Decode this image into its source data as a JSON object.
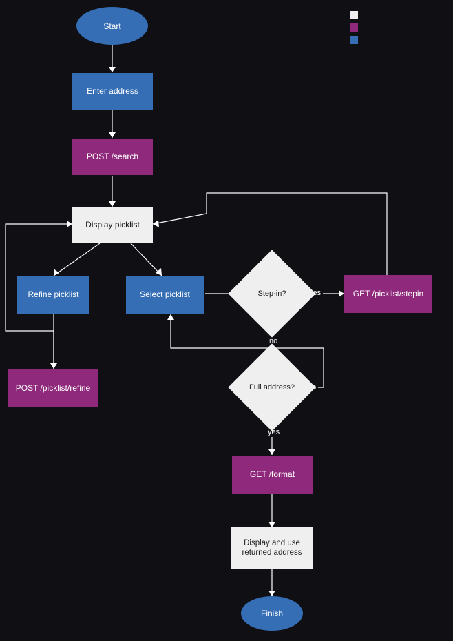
{
  "chart_data": {
    "type": "flowchart",
    "title": "",
    "nodes": [
      {
        "id": "start",
        "label": "Start",
        "shape": "ellipse",
        "color": "blue"
      },
      {
        "id": "enter_addr",
        "label": "Enter address",
        "shape": "rect",
        "color": "blue"
      },
      {
        "id": "post_search",
        "label": "POST /search",
        "shape": "rect",
        "color": "purple"
      },
      {
        "id": "display_pl",
        "label": "Display picklist",
        "shape": "rect",
        "color": "white"
      },
      {
        "id": "refine_pl",
        "label": "Refine picklist",
        "shape": "rect",
        "color": "blue"
      },
      {
        "id": "select_pl",
        "label": "Select picklist",
        "shape": "rect",
        "color": "blue"
      },
      {
        "id": "stepin_q",
        "label": "Step-in?",
        "shape": "diamond",
        "color": "white"
      },
      {
        "id": "stepin_api",
        "label": "GET /picklist/stepin",
        "shape": "rect",
        "color": "purple"
      },
      {
        "id": "post_refine",
        "label": "POST /picklist/refine",
        "shape": "rect",
        "color": "purple"
      },
      {
        "id": "fulladdr_q",
        "label": "Full address?",
        "shape": "diamond",
        "color": "white"
      },
      {
        "id": "get_format",
        "label": "GET /format",
        "shape": "rect",
        "color": "purple"
      },
      {
        "id": "display_ret",
        "label": "Display and use returned address",
        "shape": "rect",
        "color": "white"
      },
      {
        "id": "finish",
        "label": "Finish",
        "shape": "ellipse",
        "color": "blue"
      }
    ],
    "edges": [
      {
        "from": "start",
        "to": "enter_addr",
        "label": ""
      },
      {
        "from": "enter_addr",
        "to": "post_search",
        "label": ""
      },
      {
        "from": "post_search",
        "to": "display_pl",
        "label": ""
      },
      {
        "from": "display_pl",
        "to": "refine_pl",
        "label": ""
      },
      {
        "from": "display_pl",
        "to": "select_pl",
        "label": ""
      },
      {
        "from": "refine_pl",
        "to": "post_refine",
        "label": ""
      },
      {
        "from": "post_refine",
        "to": "display_pl",
        "label": ""
      },
      {
        "from": "select_pl",
        "to": "stepin_q",
        "label": ""
      },
      {
        "from": "stepin_q",
        "to": "stepin_api",
        "label": "yes"
      },
      {
        "from": "stepin_api",
        "to": "display_pl",
        "label": ""
      },
      {
        "from": "stepin_q",
        "to": "fulladdr_q",
        "label": "no"
      },
      {
        "from": "fulladdr_q",
        "to": "select_pl",
        "label": "no"
      },
      {
        "from": "fulladdr_q",
        "to": "get_format",
        "label": "yes"
      },
      {
        "from": "get_format",
        "to": "display_ret",
        "label": ""
      },
      {
        "from": "display_ret",
        "to": "finish",
        "label": ""
      }
    ],
    "edge_labels": {
      "yes": "yes",
      "no": "no"
    },
    "legend": {
      "white": "",
      "purple": "",
      "blue": ""
    }
  }
}
